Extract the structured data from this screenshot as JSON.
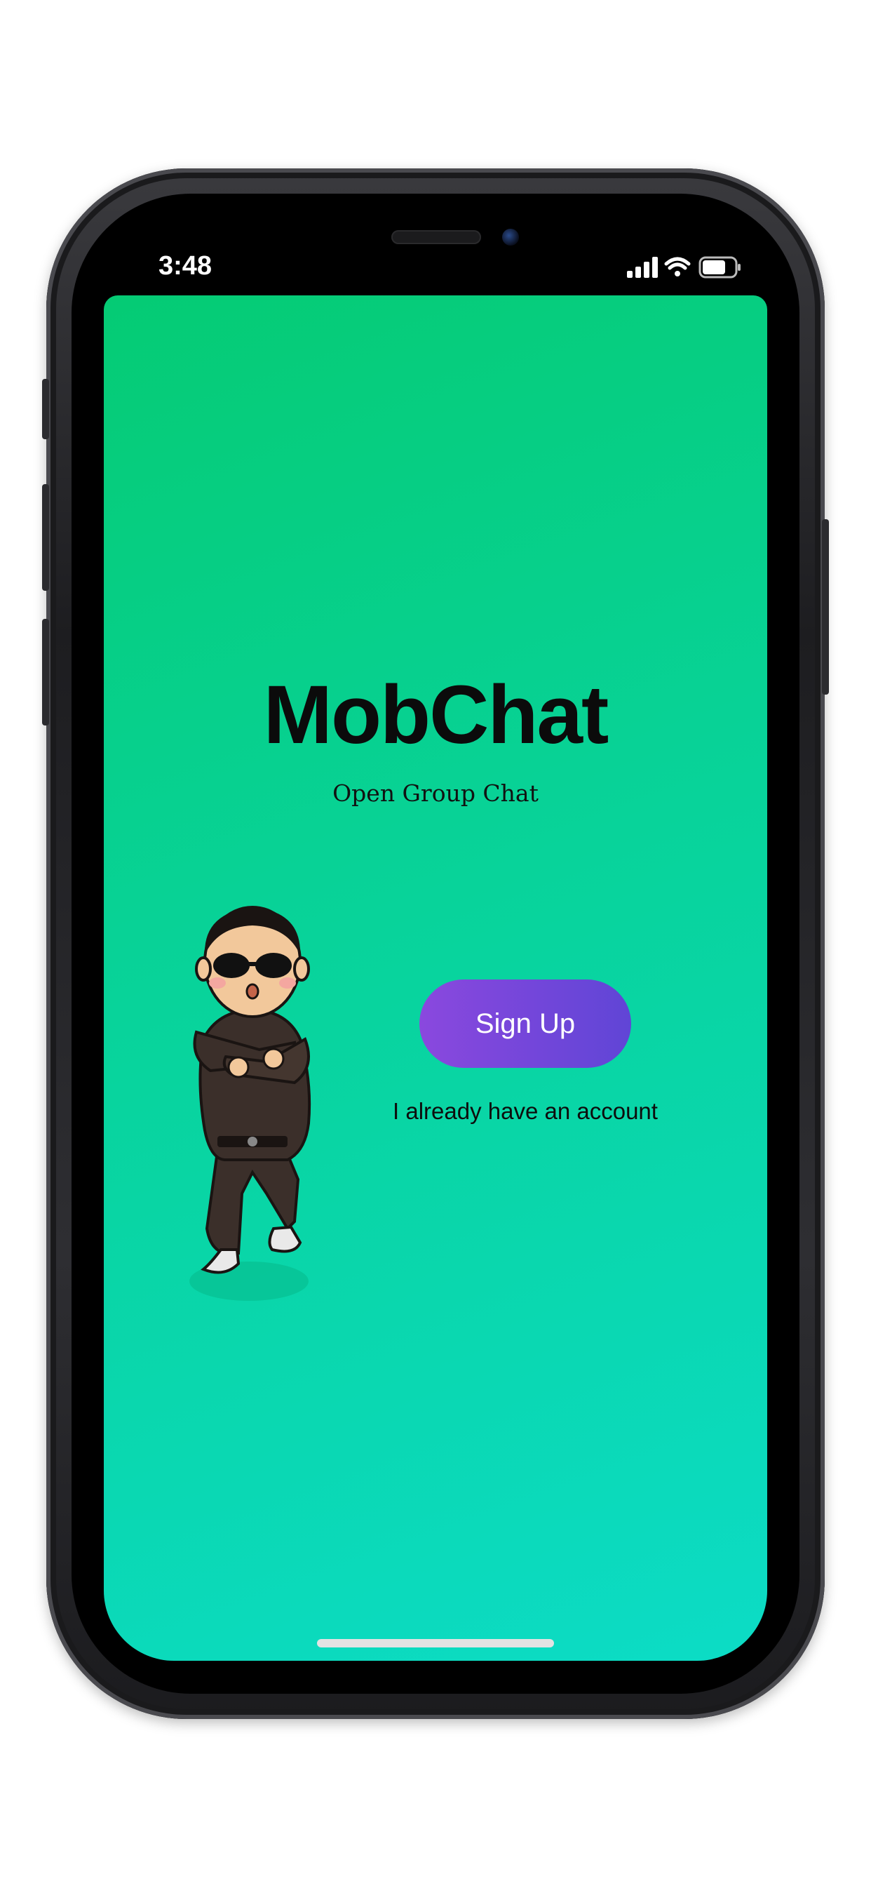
{
  "status_bar": {
    "time": "3:48",
    "icons": [
      "signal-icon",
      "wifi-icon",
      "battery-icon"
    ]
  },
  "app": {
    "title": "MobChat",
    "subtitle": "Open Group Chat",
    "signup_label": "Sign Up",
    "login_label": "I already have an account",
    "mascot": "dancing-man-illustration"
  },
  "colors": {
    "screen_gradient_start": "#05cb74",
    "screen_gradient_end": "#0cdcc6",
    "button_gradient_start": "#8a48de",
    "button_gradient_end": "#6045d6",
    "text": "#0b0b0b"
  }
}
